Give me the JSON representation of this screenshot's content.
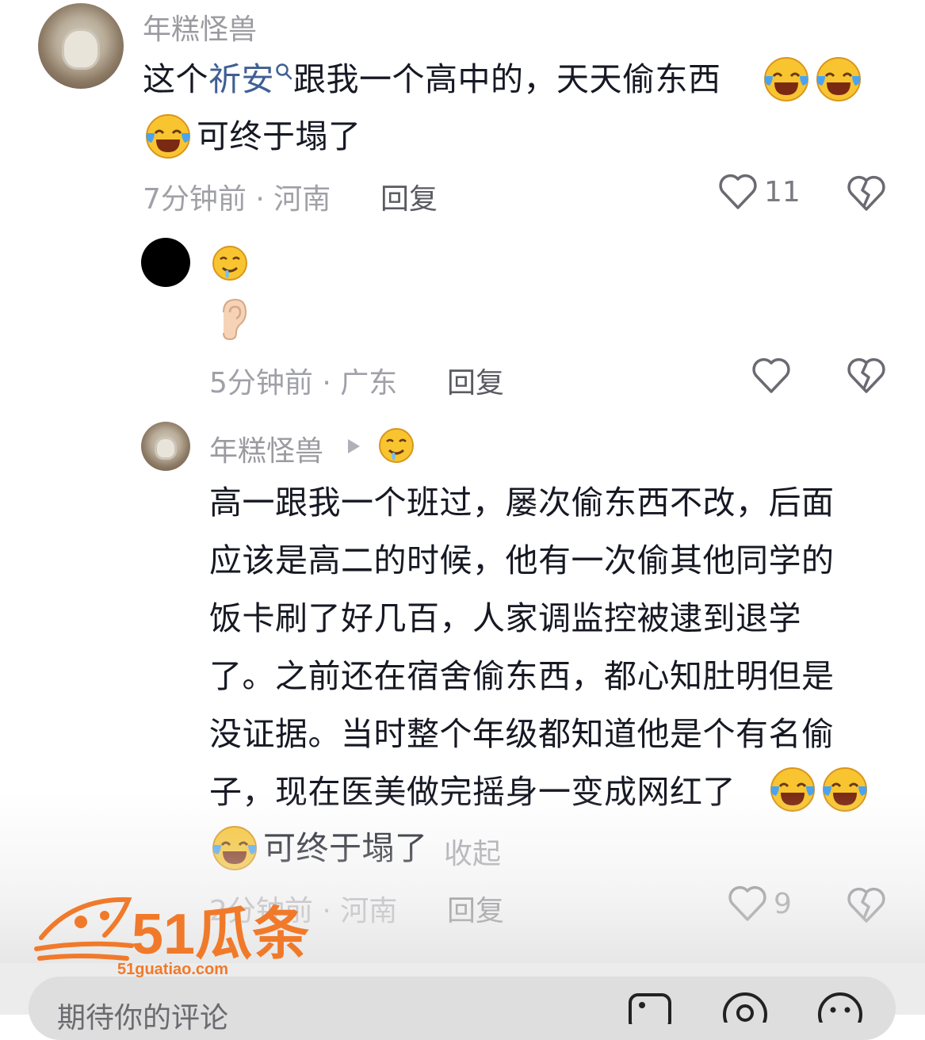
{
  "comments": [
    {
      "username": "年糕怪兽",
      "text_part1": "这个",
      "text_link": "祈安",
      "text_part2": "跟我一个高中的，天天偷东西",
      "text_line2": "可终于塌了",
      "time_location": "7分钟前 · 河南",
      "reply_label": "回复",
      "like_count": "11"
    },
    {
      "username": "",
      "emoji_line1": "drooling-face-emoji",
      "emoji_line2": "ear-emoji",
      "time_location": "5分钟前 · 广东",
      "reply_label": "回复",
      "like_count": ""
    },
    {
      "username": "年糕怪兽",
      "reply_to_emoji": "drooling-face-emoji",
      "lines": [
        "高一跟我一个班过，屡次偷东西不改，后面",
        "应该是高二的时候，他有一次偷其他同学的",
        "饭卡刷了好几百，人家调监控被逮到退学",
        "了。之前还在宿舍偷东西，都心知肚明但是",
        "没证据。当时整个年级都知道他是个有名偷",
        "子，现在医美做完摇身一变成网红了"
      ],
      "last_line": "可终于塌了",
      "collapse_label": "收起",
      "time_location": "2分钟前 · 河南",
      "reply_label": "回复",
      "like_count": "9"
    }
  ],
  "input": {
    "placeholder": "期待你的评论"
  },
  "watermark": {
    "brand": "51瓜条",
    "url": "51guatiao.com"
  },
  "colors": {
    "accent_link": "#3f5f94",
    "watermark": "#f07a2a"
  }
}
